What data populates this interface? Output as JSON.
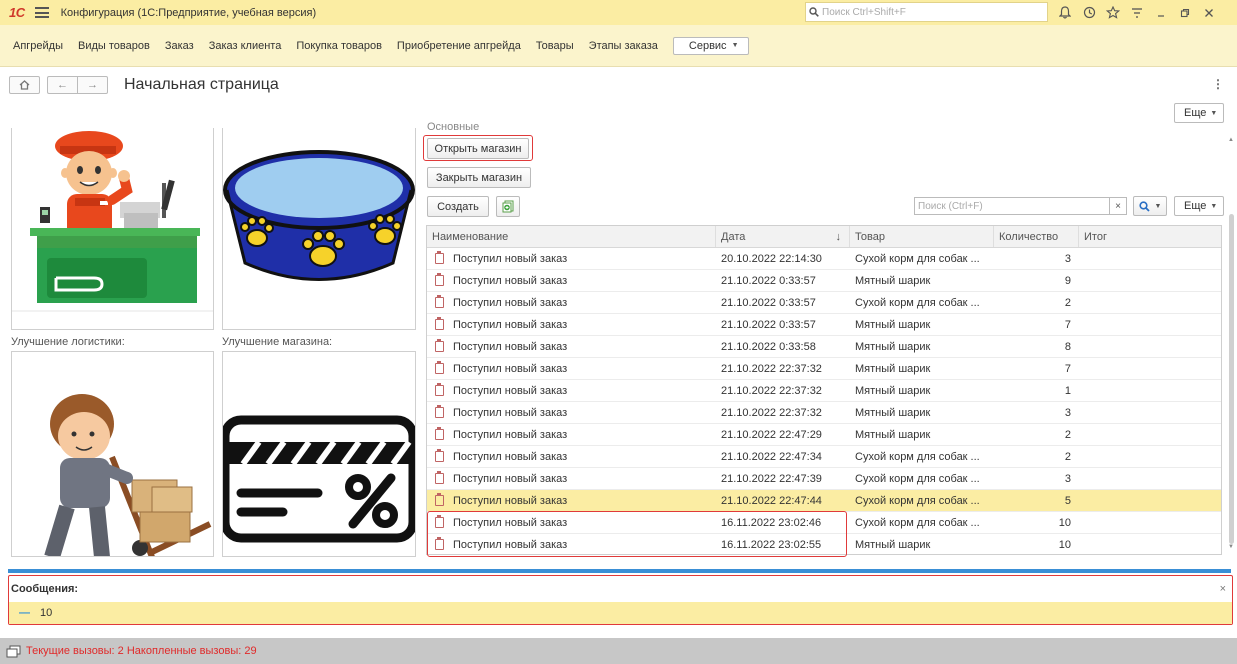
{
  "titlebar": {
    "logo": "1С",
    "title": "Конфигурация  (1С:Предприятие, учебная версия)",
    "search_placeholder": "Поиск Ctrl+Shift+F"
  },
  "sections": [
    "Апгрейды",
    "Виды товаров",
    "Заказ",
    "Заказ клиента",
    "Покупка товаров",
    "Приобретение апгрейда",
    "Товары",
    "Этапы заказа"
  ],
  "service_label": "Сервис",
  "page": {
    "title": "Начальная страница",
    "more_label": "Еще"
  },
  "left_panel": {
    "caption_logistics": "Улучшение логистики:",
    "caption_shop": "Улучшение магазина:"
  },
  "actions": {
    "group_label": "Основные",
    "open_shop": "Открыть магазин",
    "close_shop": "Закрыть магазин",
    "create": "Создать",
    "list_search_placeholder": "Поиск (Ctrl+F)",
    "more_label": "Еще"
  },
  "table": {
    "columns": [
      "Наименование",
      "Дата",
      "Товар",
      "Количество",
      "Итог"
    ],
    "sort_indicator": "↓",
    "rows": [
      {
        "name": "Поступил новый заказ",
        "date": "20.10.2022 22:14:30",
        "item": "Сухой корм для собак ...",
        "qty": "3",
        "total": ""
      },
      {
        "name": "Поступил новый заказ",
        "date": "21.10.2022 0:33:57",
        "item": "Мятный шарик",
        "qty": "9",
        "total": ""
      },
      {
        "name": "Поступил новый заказ",
        "date": "21.10.2022 0:33:57",
        "item": "Сухой корм для собак ...",
        "qty": "2",
        "total": ""
      },
      {
        "name": "Поступил новый заказ",
        "date": "21.10.2022 0:33:57",
        "item": "Мятный шарик",
        "qty": "7",
        "total": ""
      },
      {
        "name": "Поступил новый заказ",
        "date": "21.10.2022 0:33:58",
        "item": "Мятный шарик",
        "qty": "8",
        "total": ""
      },
      {
        "name": "Поступил новый заказ",
        "date": "21.10.2022 22:37:32",
        "item": "Мятный шарик",
        "qty": "7",
        "total": ""
      },
      {
        "name": "Поступил новый заказ",
        "date": "21.10.2022 22:37:32",
        "item": "Мятный шарик",
        "qty": "1",
        "total": ""
      },
      {
        "name": "Поступил новый заказ",
        "date": "21.10.2022 22:37:32",
        "item": "Мятный шарик",
        "qty": "3",
        "total": ""
      },
      {
        "name": "Поступил новый заказ",
        "date": "21.10.2022 22:47:29",
        "item": "Мятный шарик",
        "qty": "2",
        "total": ""
      },
      {
        "name": "Поступил новый заказ",
        "date": "21.10.2022 22:47:34",
        "item": "Сухой корм для собак ...",
        "qty": "2",
        "total": ""
      },
      {
        "name": "Поступил новый заказ",
        "date": "21.10.2022 22:47:39",
        "item": "Сухой корм для собак ...",
        "qty": "3",
        "total": ""
      },
      {
        "name": "Поступил новый заказ",
        "date": "21.10.2022 22:47:44",
        "item": "Сухой корм для собак ...",
        "qty": "5",
        "total": ""
      },
      {
        "name": "Поступил новый заказ",
        "date": "16.11.2022 23:02:46",
        "item": "Сухой корм для собак ...",
        "qty": "10",
        "total": ""
      },
      {
        "name": "Поступил новый заказ",
        "date": "16.11.2022 23:02:55",
        "item": "Мятный шарик",
        "qty": "10",
        "total": ""
      }
    ],
    "selected_index": 11
  },
  "messages": {
    "title": "Сообщения:",
    "close": "×",
    "items": [
      "10"
    ]
  },
  "status": {
    "text": "Текущие вызовы: 2   Накопленные вызовы: 29"
  },
  "colors": {
    "titlebar_bg": "#fbeda3",
    "sectionbar_bg": "#fbf4cc",
    "selected_row": "#fbeda3",
    "highlight_border": "#e03a3a",
    "messages_divider": "#3a8fd6",
    "status_text": "#e02a2a"
  },
  "icons": [
    "home-icon",
    "back-icon",
    "forward-icon",
    "bell-icon",
    "history-icon",
    "star-icon",
    "filter-icon",
    "minimize-icon",
    "restore-icon",
    "close-icon",
    "search-icon",
    "document-icon",
    "windows-icon"
  ]
}
